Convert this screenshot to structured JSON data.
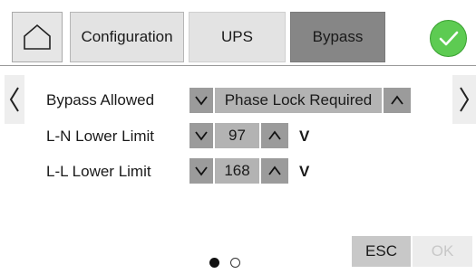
{
  "header": {
    "tabs": [
      {
        "label": "Configuration"
      },
      {
        "label": "UPS"
      },
      {
        "label": "Bypass"
      }
    ],
    "active_tab": "Bypass"
  },
  "settings": {
    "bypass_allowed": {
      "label": "Bypass Allowed",
      "value": "Phase Lock Required"
    },
    "ln_lower_limit": {
      "label": "L-N Lower Limit",
      "value": "97",
      "unit": "V"
    },
    "ll_lower_limit": {
      "label": "L-L Lower Limit",
      "value": "168",
      "unit": "V"
    }
  },
  "pagination": {
    "current": 1,
    "total": 2
  },
  "footer": {
    "esc_label": "ESC",
    "ok_label": "OK"
  },
  "colors": {
    "active_tab": "#868686",
    "confirm_green": "#5dcb52",
    "arrow_button": "#9b9b9b",
    "value_field": "#b3b3b3"
  },
  "icons": [
    "home-icon",
    "check-icon",
    "chevron-left-icon",
    "chevron-right-icon",
    "chevron-down-icon",
    "chevron-up-icon"
  ]
}
